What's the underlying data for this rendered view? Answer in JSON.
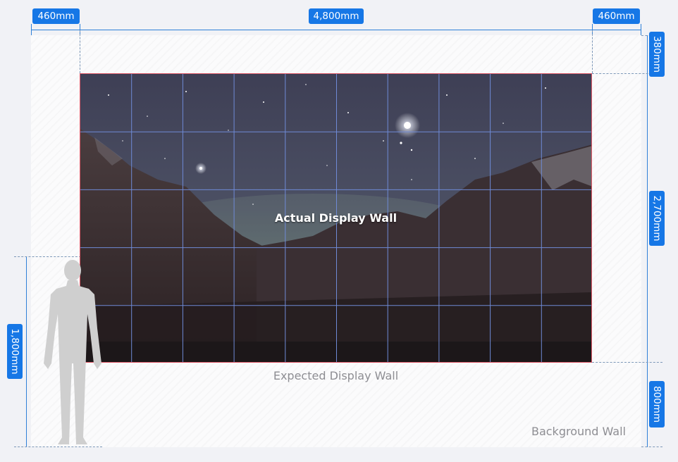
{
  "dimensions": {
    "top_left_margin": "460mm",
    "top_width": "4,800mm",
    "top_right_margin": "460mm",
    "right_top_margin": "380mm",
    "right_height": "2,700mm",
    "right_bottom_margin": "800mm",
    "left_person_height": "1,800mm"
  },
  "labels": {
    "display": "Actual Display Wall",
    "expected": "Expected Display Wall",
    "background": "Background Wall"
  },
  "grid": {
    "columns": 10,
    "rows": 5
  },
  "colors": {
    "accent": "#1677e6",
    "display_border": "#e05b6a",
    "grid_lines": "#6f8ad6",
    "background_wall": "#fbfbfc"
  },
  "icons": {
    "person": "human-silhouette-icon"
  }
}
